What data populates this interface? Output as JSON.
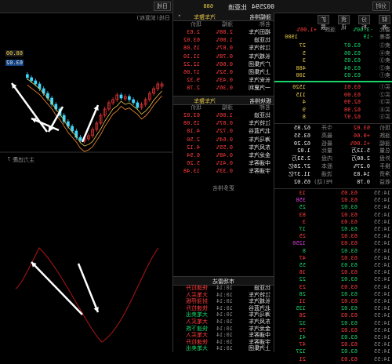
{
  "top": {
    "mode_button": "分时",
    "code": "002594",
    "name": "比亚迪",
    "right_tag": "688",
    "chart_button": "日线"
  },
  "tabs": [
    "财务",
    "分析",
    "资讯",
    "扩展"
  ],
  "quote": {
    "change_label": "涨跌",
    "change_value": "+1.06%",
    "ratio_label": "委比",
    "ratio_value": "-3.60%",
    "diff_label": "委差",
    "diff_value": "-19",
    "volume_badge": "1900"
  },
  "order_book": {
    "asks": [
      {
        "label": "卖⑤",
        "price": "63.07",
        "vol": "27"
      },
      {
        "label": "卖④",
        "price": "63.06",
        "vol": "5"
      },
      {
        "label": "卖③",
        "price": "63.05",
        "vol": "3"
      },
      {
        "label": "卖②",
        "price": "63.04",
        "vol": "488"
      },
      {
        "label": "卖①",
        "price": "63.03",
        "vol": "100"
      }
    ],
    "bids": [
      {
        "label": "买①",
        "price": "63.01",
        "vol": "1520"
      },
      {
        "label": "买②",
        "price": "63.00",
        "vol": "115"
      },
      {
        "label": "买③",
        "price": "62.99",
        "vol": "4"
      },
      {
        "label": "买④",
        "price": "62.98",
        "vol": "9"
      },
      {
        "label": "买⑤",
        "price": "62.97",
        "vol": "8"
      }
    ]
  },
  "stats": [
    {
      "k": "现价",
      "v": "63.02",
      "k2": "今开",
      "v2": "62.85"
    },
    {
      "k": "涨跌",
      "v": "+0.66",
      "k2": "最高",
      "v2": "63.55"
    },
    {
      "k": "涨幅",
      "v": "+1.06%",
      "k2": "最低",
      "v2": "62.20"
    },
    {
      "k": "总量",
      "v": "5.13万",
      "k2": "量比",
      "v2": "1.02"
    },
    {
      "k": "外盘",
      "v": "2.60万",
      "k2": "内盘",
      "v2": "2.53万"
    },
    {
      "k": "换手",
      "v": "0.27%",
      "k2": "股本",
      "v2": "27.28亿"
    },
    {
      "k": "净资",
      "v": "14.83",
      "k2": "流通",
      "v2": "11.37亿"
    },
    {
      "k": "收益",
      "v": "0.78",
      "k2": "PE(动)",
      "v2": "65.02"
    }
  ],
  "ticks": [
    {
      "t": "14:55",
      "p": "63.05",
      "v": "13",
      "c": "red"
    },
    {
      "t": "14:55",
      "p": "63.02",
      "v": "358",
      "c": "mag"
    },
    {
      "t": "14:55",
      "p": "63.02",
      "v": "25",
      "c": "green"
    },
    {
      "t": "14:55",
      "p": "63.02",
      "v": "83",
      "c": "red"
    },
    {
      "t": "14:55",
      "p": "63.03",
      "v": "3",
      "c": "red"
    },
    {
      "t": "14:55",
      "p": "63.02",
      "v": "17",
      "c": "green"
    },
    {
      "t": "14:55",
      "p": "63.02",
      "v": "25",
      "c": "red"
    },
    {
      "t": "14:55",
      "p": "63.03",
      "v": "1250",
      "c": "mag"
    },
    {
      "t": "14:55",
      "p": "63.02",
      "v": "8",
      "c": "green"
    },
    {
      "t": "14:55",
      "p": "63.02",
      "v": "47",
      "c": "red"
    },
    {
      "t": "14:55",
      "p": "63.03",
      "v": "55",
      "c": "green"
    },
    {
      "t": "14:55",
      "p": "63.02",
      "v": "16",
      "c": "red"
    },
    {
      "t": "14:55",
      "p": "63.02",
      "v": "22",
      "c": "green"
    },
    {
      "t": "14:55",
      "p": "63.03",
      "v": "23",
      "c": "red"
    },
    {
      "t": "14:55",
      "p": "63.02",
      "v": "28",
      "c": "green"
    },
    {
      "t": "14:55",
      "p": "63.02",
      "v": "11",
      "c": "red"
    },
    {
      "t": "14:55",
      "p": "63.02",
      "v": "135",
      "c": "green"
    },
    {
      "t": "14:55",
      "p": "63.03",
      "v": "26",
      "c": "red"
    },
    {
      "t": "14:55",
      "p": "63.02",
      "v": "32",
      "c": "green"
    },
    {
      "t": "14:55",
      "p": "63.02",
      "v": "73",
      "c": "red"
    },
    {
      "t": "14:55",
      "p": "63.03",
      "v": "41",
      "c": "green"
    },
    {
      "t": "14:55",
      "p": "63.02",
      "v": "47",
      "c": "red"
    },
    {
      "t": "14:55",
      "p": "63.02",
      "v": "127",
      "c": "green"
    },
    {
      "t": "14:55",
      "p": "63.03",
      "v": "21",
      "c": "red"
    }
  ],
  "rank_panel_1": {
    "title": "涨幅排名",
    "dropdown": "汽车整车",
    "headers": [
      "名称",
      "涨幅",
      "现价"
    ],
    "rows": [
      {
        "n": "福田汽车",
        "c": "2.08%",
        "p": "2.63"
      },
      {
        "n": "比亚迪",
        "c": "1.06%",
        "p": "63.02"
      },
      {
        "n": "江铃汽车",
        "c": "0.87%",
        "p": "15.08"
      },
      {
        "n": "长城汽车",
        "c": "0.78%",
        "p": "11.10"
      },
      {
        "n": "广汽集团",
        "c": "0.66%",
        "p": "12.22"
      },
      {
        "n": "上汽集团",
        "c": "0.52%",
        "p": "17.06"
      },
      {
        "n": "长安汽车",
        "c": "0.43%",
        "p": "9.32"
      },
      {
        "n": "一汽夏利",
        "c": "0.36%",
        "p": "2.78"
      }
    ]
  },
  "rank_panel_2": {
    "title": "板块排名",
    "dropdown": "汽车整车",
    "headers": [
      "名称",
      "涨幅",
      "现价"
    ],
    "rows": [
      {
        "n": "比亚迪",
        "c": "1.06%",
        "p": "63.02"
      },
      {
        "n": "江铃汽车",
        "c": "0.87%",
        "p": "15.08"
      },
      {
        "n": "北汽蓝谷",
        "c": "0.72%",
        "p": "4.18"
      },
      {
        "n": "海马汽车",
        "c": "0.64%",
        "p": "2.50"
      },
      {
        "n": "东风汽车",
        "c": "0.55%",
        "p": "4.12"
      },
      {
        "n": "金龙汽车",
        "c": "0.48%",
        "p": "6.94"
      },
      {
        "n": "中通客车",
        "c": "0.41%",
        "p": "5.26"
      },
      {
        "n": "宇通客车",
        "c": "0.33%",
        "p": "13.48"
      }
    ],
    "footer": "更多排名"
  },
  "fund_panel": {
    "title": "市场雷达",
    "rows": [
      {
        "n": "比亚迪",
        "t": "10:14",
        "a": "快速拉升"
      },
      {
        "n": "江铃汽车",
        "t": "10:14",
        "a": "大笔买入"
      },
      {
        "n": "长城汽车",
        "t": "10:14",
        "a": "封涨停板"
      },
      {
        "n": "北汽蓝谷",
        "t": "10:14",
        "a": "快速拉升"
      },
      {
        "n": "海马汽车",
        "t": "10:14",
        "a": "大笔卖出"
      },
      {
        "n": "东风汽车",
        "t": "10:14",
        "a": "大笔买入"
      },
      {
        "n": "金龙汽车",
        "t": "10:14",
        "a": "快速下跌"
      },
      {
        "n": "中通客车",
        "t": "10:14",
        "a": "大笔买入"
      },
      {
        "n": "宇通客车",
        "t": "10:14",
        "a": "快速拉升"
      },
      {
        "n": "上汽集团",
        "t": "10:14",
        "a": "大笔卖出"
      }
    ]
  },
  "kline": {
    "label": "日线(前复权)",
    "price_tags": [
      "68.00",
      "63.02"
    ],
    "indicator_label": "主力追踪",
    "indicator_value": "T 7"
  },
  "colors": {
    "up": "#ff3b3b",
    "down": "#19d36b",
    "candle_up": "#3fd7ff",
    "ma1": "#e6c84a",
    "ma2": "#ff8a30",
    "indicator": "#b01515"
  }
}
